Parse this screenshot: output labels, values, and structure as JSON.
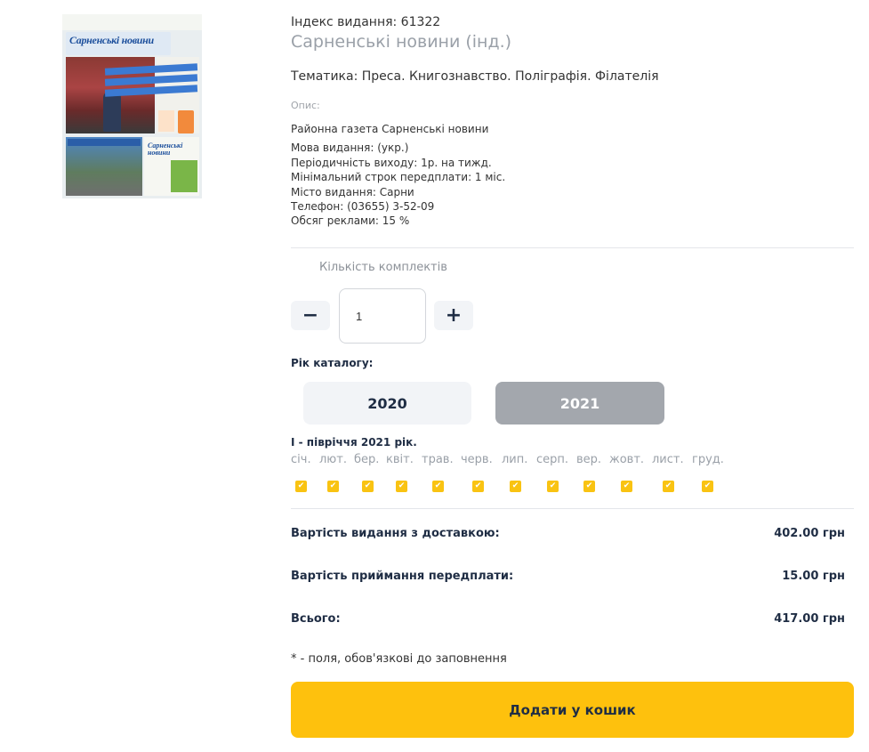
{
  "product": {
    "cover_masthead": "Сарненські новини",
    "index_line": "Індекс видання: 61322",
    "title": "Сарненські новини (інд.)",
    "theme_line": "Тематика: Преса. Книгознавство. Поліграфія. Філателія",
    "description_label": "Опис:",
    "description_title": "Районна газета Сарненські новини",
    "details": [
      "Мова видання: (укр.)",
      "Періодичність виходу: 1р. на тижд.",
      "Мінімальний строк передплати: 1 міс.",
      "Місто видання: Сарни",
      "Телефон: (03655) 3-52-09",
      "Обсяг реклами: 15 %"
    ]
  },
  "quantity": {
    "label": "Кількість комплектів",
    "minus": "−",
    "plus": "+",
    "value": "1"
  },
  "catalog_year": {
    "label": "Рік каталогу:",
    "options": [
      "2020",
      "2021"
    ],
    "selected": "2021"
  },
  "period": {
    "title": "I - півріччя 2021 рік.",
    "months": [
      "січ.",
      "лют.",
      "бер.",
      "квіт.",
      "трав.",
      "черв.",
      "лип.",
      "серп.",
      "вер.",
      "жовт.",
      "лист.",
      "груд."
    ],
    "checked": [
      true,
      true,
      true,
      true,
      true,
      true,
      true,
      true,
      true,
      true,
      true,
      true
    ]
  },
  "prices": [
    {
      "label": "Вартість видання з доставкою:",
      "value": "402.00 грн"
    },
    {
      "label": "Вартість приймання передплати:",
      "value": "15.00 грн"
    },
    {
      "label": "Всього:",
      "value": "417.00 грн"
    }
  ],
  "required_note": "* - поля, обов'язкові до заповнення",
  "add_to_cart": "Додати у кошик",
  "colors": {
    "accent": "#fec10d",
    "checkbox": "#f9c312",
    "selected_year": "#a3a7ad",
    "text_dark": "#1f2d44"
  }
}
